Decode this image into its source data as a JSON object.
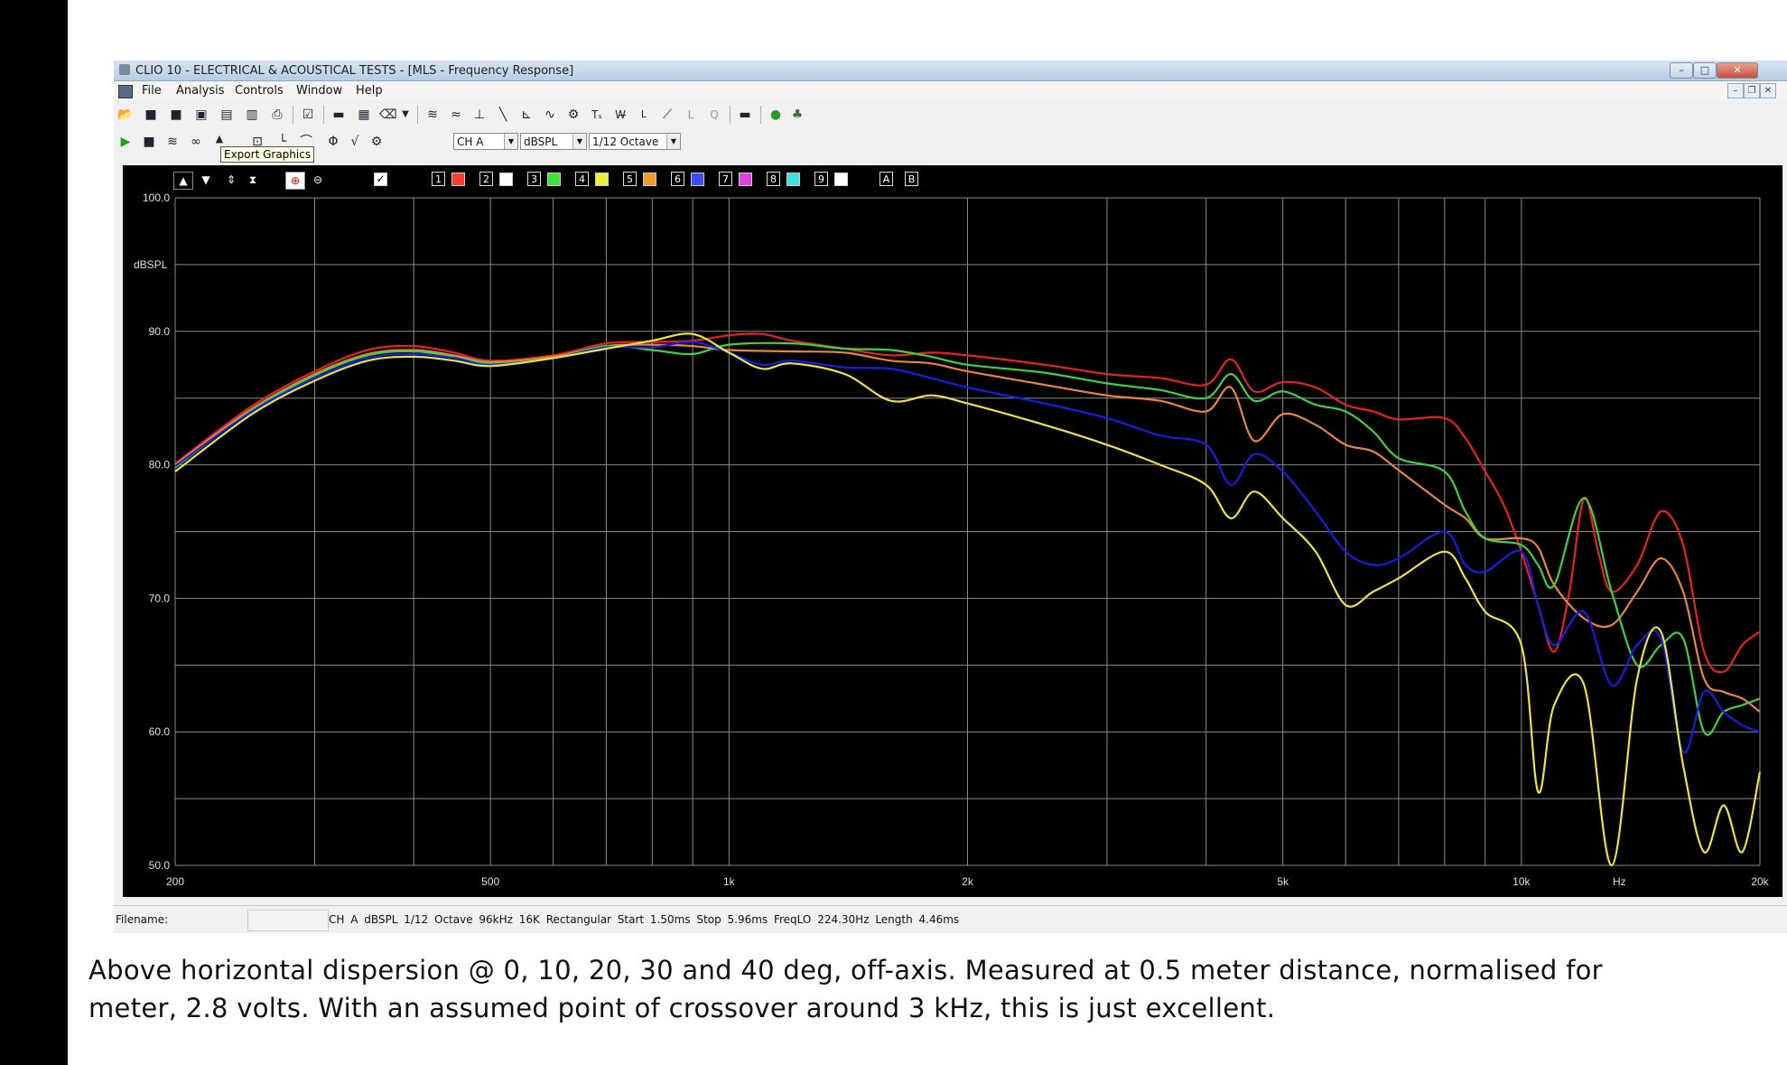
{
  "window": {
    "title": "CLIO 10 - ELECTRICAL & ACOUSTICAL TESTS - [MLS - Frequency Response]",
    "minimize": "–",
    "maximize": "□",
    "close": "✕"
  },
  "menu": {
    "items": [
      "File",
      "Analysis",
      "Controls",
      "Window",
      "Help"
    ]
  },
  "toolbar2": {
    "channel": "CH A",
    "unit": "dBSPL",
    "smoothing": "1/12 Octave",
    "tooltip": "Export Graphics"
  },
  "graph_controls": {
    "checkbox_slots": [
      "1",
      "2",
      "3",
      "4",
      "5",
      "6",
      "7",
      "8",
      "9"
    ],
    "slot_colors": [
      "#ff3b2f",
      "#ffffff",
      "#3ee03e",
      "#f0f03c",
      "#f29a30",
      "#3b4bff",
      "#e040e0",
      "#40e0e0",
      "#ffffff"
    ],
    "ab": [
      "A",
      "B"
    ]
  },
  "status": {
    "filename_label": "Filename:",
    "params": "CH A  dBSPL  1/12 Octave  96kHz  16K  Rectangular  Start 1.50ms  Stop 5.96ms  FreqLO 224.30Hz  Length 4.46ms"
  },
  "caption": "Above horizontal dispersion @ 0, 10, 20, 30 and 40 deg, off-axis. Measured at 0.5 meter distance, normalised for\nmeter, 2.8 volts. With an assumed point of crossover around 3 kHz, this is just excellent.",
  "chart_data": {
    "type": "line",
    "title": "",
    "xlabel": "Hz",
    "ylabel": "dBSPL",
    "x_scale": "log",
    "xlim": [
      200,
      20000
    ],
    "ylim": [
      50,
      100
    ],
    "grid": true,
    "background": "#000000",
    "x_ticks": [
      {
        "value": 200,
        "label": "200"
      },
      {
        "value": 500,
        "label": "500"
      },
      {
        "value": 1000,
        "label": "1k"
      },
      {
        "value": 2000,
        "label": "2k"
      },
      {
        "value": 5000,
        "label": "5k"
      },
      {
        "value": 10000,
        "label": "10k"
      },
      {
        "value": 20000,
        "label": "20k"
      }
    ],
    "y_ticks": [
      {
        "value": 100,
        "label": "100.0"
      },
      {
        "value": 90,
        "label": "90.0"
      },
      {
        "value": 80,
        "label": "80.0"
      },
      {
        "value": 70,
        "label": "70.0"
      },
      {
        "value": 60,
        "label": "60.0"
      },
      {
        "value": 50,
        "label": "50.0"
      }
    ],
    "series": [
      {
        "color": "#e8231d",
        "points": [
          [
            200,
            80.1
          ],
          [
            250,
            84.4
          ],
          [
            300,
            87.0
          ],
          [
            350,
            88.6
          ],
          [
            400,
            88.9
          ],
          [
            450,
            88.4
          ],
          [
            500,
            87.8
          ],
          [
            600,
            88.2
          ],
          [
            700,
            89.1
          ],
          [
            800,
            89.2
          ],
          [
            900,
            89.3
          ],
          [
            1000,
            89.7
          ],
          [
            1100,
            89.8
          ],
          [
            1200,
            89.3
          ],
          [
            1400,
            88.7
          ],
          [
            1600,
            88.2
          ],
          [
            1800,
            88.4
          ],
          [
            2000,
            88.2
          ],
          [
            2500,
            87.5
          ],
          [
            3000,
            86.8
          ],
          [
            3500,
            86.5
          ],
          [
            4000,
            86.0
          ],
          [
            4300,
            87.9
          ],
          [
            4600,
            85.5
          ],
          [
            5000,
            86.2
          ],
          [
            5500,
            85.8
          ],
          [
            6000,
            84.5
          ],
          [
            6500,
            84.0
          ],
          [
            7000,
            83.4
          ],
          [
            8000,
            83.5
          ],
          [
            8500,
            82.0
          ],
          [
            9000,
            79.5
          ],
          [
            9500,
            77.0
          ],
          [
            10000,
            73.5
          ],
          [
            10500,
            69.5
          ],
          [
            11000,
            66.0
          ],
          [
            11500,
            70.5
          ],
          [
            12000,
            77.5
          ],
          [
            12500,
            73.5
          ],
          [
            13000,
            70.5
          ],
          [
            14000,
            72.5
          ],
          [
            15000,
            76.5
          ],
          [
            16000,
            74.0
          ],
          [
            17000,
            66.0
          ],
          [
            18000,
            64.5
          ],
          [
            19000,
            66.5
          ],
          [
            20000,
            67.5
          ]
        ]
      },
      {
        "color": "#e9863a",
        "points": [
          [
            200,
            80.0
          ],
          [
            250,
            84.2
          ],
          [
            300,
            86.8
          ],
          [
            350,
            88.3
          ],
          [
            400,
            88.6
          ],
          [
            450,
            88.2
          ],
          [
            500,
            87.7
          ],
          [
            600,
            88.1
          ],
          [
            700,
            88.9
          ],
          [
            800,
            89.0
          ],
          [
            900,
            88.9
          ],
          [
            1000,
            88.6
          ],
          [
            1200,
            88.5
          ],
          [
            1400,
            88.4
          ],
          [
            1600,
            87.8
          ],
          [
            1800,
            87.6
          ],
          [
            2000,
            87.0
          ],
          [
            2500,
            86.0
          ],
          [
            3000,
            85.2
          ],
          [
            3500,
            84.8
          ],
          [
            4000,
            84.0
          ],
          [
            4300,
            85.8
          ],
          [
            4600,
            81.8
          ],
          [
            5000,
            83.8
          ],
          [
            5500,
            83.0
          ],
          [
            6000,
            81.5
          ],
          [
            6500,
            81.0
          ],
          [
            7000,
            79.6
          ],
          [
            8000,
            77.0
          ],
          [
            8500,
            76.0
          ],
          [
            9000,
            74.5
          ],
          [
            10000,
            74.5
          ],
          [
            10500,
            73.8
          ],
          [
            11000,
            71.0
          ],
          [
            12000,
            68.5
          ],
          [
            13000,
            68.0
          ],
          [
            14000,
            70.5
          ],
          [
            15000,
            73.0
          ],
          [
            16000,
            70.5
          ],
          [
            17000,
            64.0
          ],
          [
            18000,
            63.0
          ],
          [
            19000,
            62.5
          ],
          [
            20000,
            61.5
          ]
        ]
      },
      {
        "color": "#3ed23e",
        "points": [
          [
            200,
            79.8
          ],
          [
            250,
            84.1
          ],
          [
            300,
            86.7
          ],
          [
            350,
            88.2
          ],
          [
            400,
            88.5
          ],
          [
            450,
            88.1
          ],
          [
            500,
            87.6
          ],
          [
            600,
            88.0
          ],
          [
            700,
            88.9
          ],
          [
            800,
            88.6
          ],
          [
            900,
            88.3
          ],
          [
            1000,
            89.0
          ],
          [
            1200,
            89.1
          ],
          [
            1400,
            88.7
          ],
          [
            1600,
            88.6
          ],
          [
            1800,
            88.1
          ],
          [
            2000,
            87.5
          ],
          [
            2500,
            86.9
          ],
          [
            3000,
            86.1
          ],
          [
            3500,
            85.6
          ],
          [
            4000,
            85.0
          ],
          [
            4300,
            86.8
          ],
          [
            4600,
            84.8
          ],
          [
            5000,
            85.5
          ],
          [
            5500,
            84.5
          ],
          [
            6000,
            84.0
          ],
          [
            6500,
            82.5
          ],
          [
            7000,
            80.5
          ],
          [
            8000,
            79.5
          ],
          [
            8500,
            76.5
          ],
          [
            9000,
            74.5
          ],
          [
            10000,
            74.0
          ],
          [
            10500,
            72.5
          ],
          [
            11000,
            71.0
          ],
          [
            12000,
            77.5
          ],
          [
            13000,
            70.5
          ],
          [
            14000,
            65.0
          ],
          [
            15000,
            66.5
          ],
          [
            16000,
            67.0
          ],
          [
            17000,
            60.0
          ],
          [
            18000,
            61.5
          ],
          [
            19000,
            62.0
          ],
          [
            20000,
            62.5
          ]
        ]
      },
      {
        "color": "#1b1be6",
        "points": [
          [
            200,
            79.9
          ],
          [
            250,
            84.0
          ],
          [
            300,
            86.5
          ],
          [
            350,
            88.0
          ],
          [
            400,
            88.3
          ],
          [
            450,
            88.0
          ],
          [
            500,
            87.5
          ],
          [
            600,
            88.0
          ],
          [
            700,
            88.8
          ],
          [
            800,
            88.8
          ],
          [
            900,
            89.2
          ],
          [
            1000,
            88.4
          ],
          [
            1100,
            87.5
          ],
          [
            1200,
            87.8
          ],
          [
            1400,
            87.3
          ],
          [
            1600,
            87.2
          ],
          [
            1800,
            86.5
          ],
          [
            2000,
            85.8
          ],
          [
            2500,
            84.6
          ],
          [
            3000,
            83.5
          ],
          [
            3500,
            82.2
          ],
          [
            4000,
            81.5
          ],
          [
            4300,
            78.5
          ],
          [
            4600,
            80.8
          ],
          [
            5000,
            79.5
          ],
          [
            5500,
            76.5
          ],
          [
            6000,
            73.5
          ],
          [
            6500,
            72.5
          ],
          [
            7000,
            73.0
          ],
          [
            8000,
            75.0
          ],
          [
            8500,
            72.5
          ],
          [
            9000,
            72.0
          ],
          [
            10000,
            73.5
          ],
          [
            10500,
            69.5
          ],
          [
            11000,
            66.5
          ],
          [
            12000,
            69.0
          ],
          [
            13000,
            63.5
          ],
          [
            14000,
            66.5
          ],
          [
            15000,
            67.0
          ],
          [
            16000,
            58.5
          ],
          [
            17000,
            63.0
          ],
          [
            18000,
            61.5
          ],
          [
            19000,
            60.5
          ],
          [
            20000,
            60.0
          ]
        ]
      },
      {
        "color": "#ece240",
        "points": [
          [
            200,
            79.5
          ],
          [
            250,
            83.8
          ],
          [
            300,
            86.3
          ],
          [
            350,
            87.8
          ],
          [
            400,
            88.1
          ],
          [
            450,
            87.8
          ],
          [
            500,
            87.4
          ],
          [
            600,
            88.0
          ],
          [
            700,
            88.7
          ],
          [
            800,
            89.3
          ],
          [
            900,
            89.8
          ],
          [
            1000,
            88.4
          ],
          [
            1100,
            87.2
          ],
          [
            1200,
            87.6
          ],
          [
            1400,
            86.8
          ],
          [
            1600,
            84.8
          ],
          [
            1800,
            85.2
          ],
          [
            2000,
            84.6
          ],
          [
            2500,
            83.0
          ],
          [
            3000,
            81.5
          ],
          [
            3500,
            80.0
          ],
          [
            4000,
            78.5
          ],
          [
            4300,
            76.0
          ],
          [
            4600,
            78.0
          ],
          [
            5000,
            76.0
          ],
          [
            5500,
            73.5
          ],
          [
            6000,
            69.5
          ],
          [
            6500,
            70.5
          ],
          [
            7000,
            71.5
          ],
          [
            8000,
            73.5
          ],
          [
            8500,
            71.5
          ],
          [
            9000,
            69.0
          ],
          [
            10000,
            66.5
          ],
          [
            10500,
            55.5
          ],
          [
            11000,
            62.0
          ],
          [
            12000,
            63.5
          ],
          [
            13000,
            50.0
          ],
          [
            14000,
            64.0
          ],
          [
            15000,
            67.5
          ],
          [
            16000,
            57.5
          ],
          [
            17000,
            51.0
          ],
          [
            18000,
            54.5
          ],
          [
            19000,
            51.0
          ],
          [
            20000,
            57.0
          ]
        ]
      }
    ]
  }
}
